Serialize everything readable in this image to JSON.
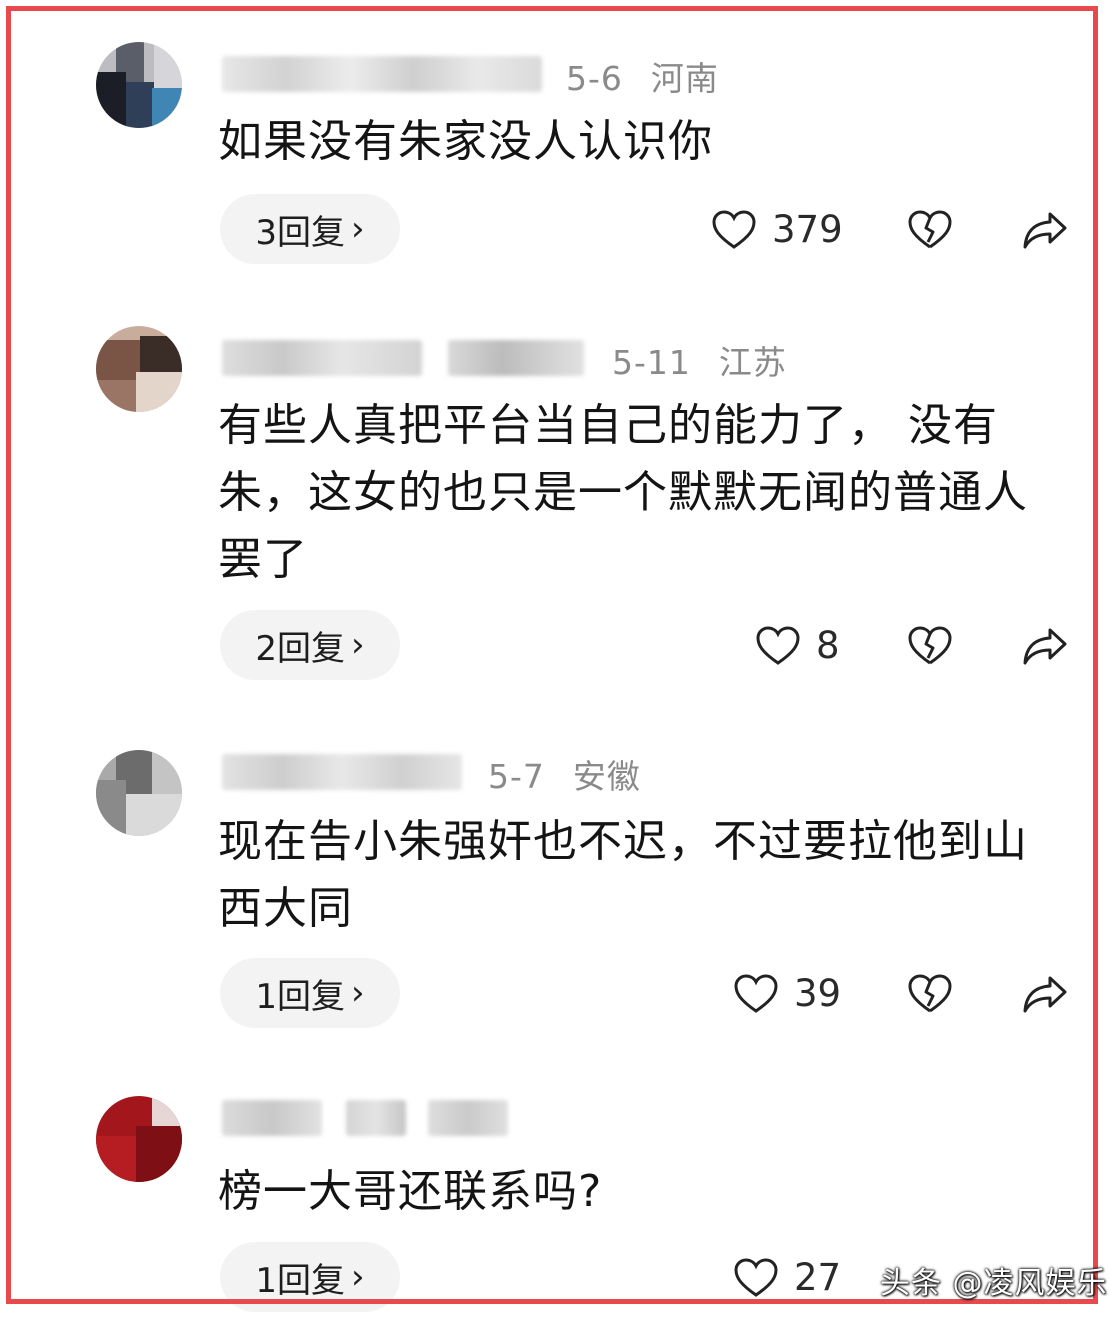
{
  "comments": [
    {
      "date": "5-6",
      "location": "河南",
      "text": "如果没有朱家没人认识你",
      "reply_label": "3回复",
      "likes": "379",
      "avatar_colors": [
        "#4a4f5a",
        "#c9c6c8",
        "#1b1e26",
        "#2f6f9a",
        "#8a8d94"
      ]
    },
    {
      "date": "5-11",
      "location": "江苏",
      "text": "有些人真把平台当自己的能力了， 没有朱，这女的也只是一个默默无闻的普通人罢了",
      "reply_label": "2回复",
      "likes": "8",
      "avatar_colors": [
        "#7a5445",
        "#c39f88",
        "#3a2d28",
        "#e0d0c4",
        "#9a7566"
      ]
    },
    {
      "date": "5-7",
      "location": "安徽",
      "text": "现在告小朱强奸也不迟，不过要拉他到山西大同",
      "reply_label": "1回复",
      "likes": "39",
      "avatar_colors": [
        "#7c7c7c",
        "#bdbdbd",
        "#5a5a5a",
        "#e2e2e2",
        "#9a9a9a"
      ]
    },
    {
      "date": "",
      "location": "",
      "text": "榜一大哥还联系吗?",
      "reply_label": "1回复",
      "likes": "27",
      "avatar_colors": [
        "#a3161c",
        "#c0282c",
        "#7e0f14",
        "#e7d6d6",
        "#b51d22"
      ]
    }
  ],
  "watermark": "头条 @凌风娱乐"
}
